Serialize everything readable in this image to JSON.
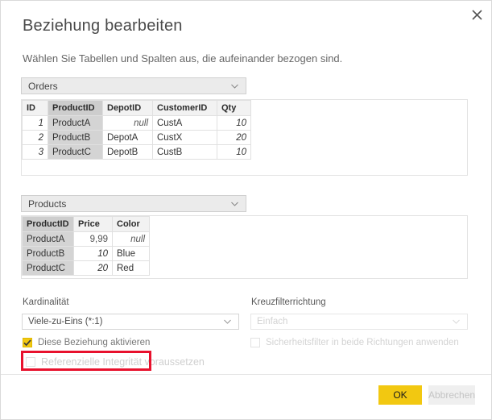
{
  "dialog": {
    "title": "Beziehung bearbeiten",
    "subtitle": "Wählen Sie Tabellen und Spalten aus, die aufeinander bezogen sind.",
    "close_icon": "close-icon"
  },
  "primary_table": {
    "selector_value": "Orders",
    "caret_icon": "chevron-down-icon",
    "selected_column": "ProductID",
    "columns": [
      "ID",
      "ProductID",
      "DepotID",
      "CustomerID",
      "Qty"
    ],
    "rows": [
      [
        "1",
        "ProductA",
        "null",
        "CustA",
        "10"
      ],
      [
        "2",
        "ProductB",
        "DepotA",
        "CustX",
        "20"
      ],
      [
        "3",
        "ProductC",
        "DepotB",
        "CustB",
        "10"
      ]
    ]
  },
  "related_table": {
    "selector_value": "Products",
    "caret_icon": "chevron-down-icon",
    "selected_column": "ProductID",
    "columns": [
      "ProductID",
      "Price",
      "Color"
    ],
    "rows": [
      [
        "ProductA",
        "9,99",
        "null"
      ],
      [
        "ProductB",
        "10",
        "Blue"
      ],
      [
        "ProductC",
        "20",
        "Red"
      ]
    ]
  },
  "options": {
    "cardinality_label": "Kardinalität",
    "cardinality_value": "Viele-zu-Eins (*:1)",
    "cross_filter_label": "Kreuzfilterrichtung",
    "cross_filter_value": "Einfach",
    "activate_relationship_label": "Diese Beziehung aktivieren",
    "activate_relationship_checked": "true",
    "referential_integrity_label": "Referenzielle Integrität voraussetzen",
    "referential_integrity_checked": "false",
    "security_filter_label": "Sicherheitsfilter in beide Richtungen anwenden",
    "security_filter_checked": "false",
    "caret_icon": "chevron-down-icon"
  },
  "footer": {
    "ok_label": "OK",
    "cancel_label": "Abbrechen"
  },
  "annotation": {
    "highlight_color": "#e8112d",
    "target": "referential-integrity-checkbox-row"
  }
}
